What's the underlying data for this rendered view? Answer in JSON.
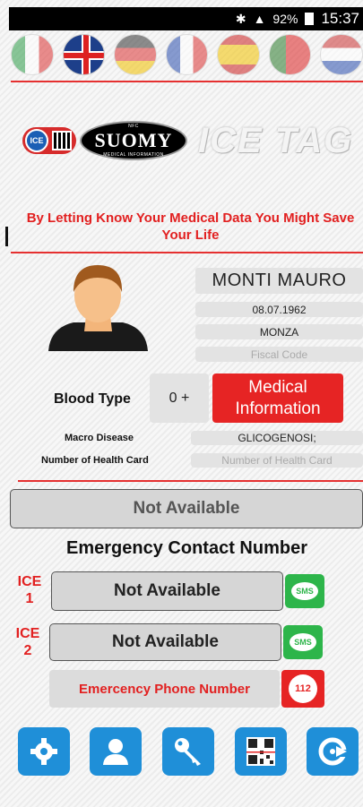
{
  "status_bar": {
    "battery": "92%",
    "time": "15:37"
  },
  "languages": [
    {
      "name": "italian-flag",
      "active": false
    },
    {
      "name": "english-flag",
      "active": true
    },
    {
      "name": "german-flag",
      "active": false
    },
    {
      "name": "french-flag",
      "active": false
    },
    {
      "name": "spanish-flag",
      "active": false
    },
    {
      "name": "portuguese-flag",
      "active": false
    },
    {
      "name": "dutch-flag",
      "active": false
    }
  ],
  "logo": {
    "ice": "ICE",
    "brand": "SUOMY",
    "brand_sub": "MEDICAL INFORMATION",
    "nfc": "NFC",
    "app_name": "ICE TAG"
  },
  "slogan": "By Letting Know Your Medical Data You Might Save Your Life",
  "profile": {
    "name": "MONTI MAURO",
    "birth_date": "08.07.1962",
    "city": "MONZA",
    "fiscal_code_placeholder": "Fiscal Code"
  },
  "blood": {
    "label": "Blood Type",
    "value": "0 +"
  },
  "medical_button": "Medical Information",
  "macro_disease": {
    "label": "Macro Disease",
    "value": "GLICOGENOSI;"
  },
  "health_card": {
    "label": "Number of Health Card",
    "placeholder": "Number of Health Card"
  },
  "not_available_main": "Not Available",
  "emergency": {
    "title": "Emergency Contact Number",
    "ice1": {
      "tag": "ICE 1",
      "value": "Not Available"
    },
    "ice2": {
      "tag": "ICE 2",
      "value": "Not Available"
    },
    "sms_label": "SMS",
    "phone_label": "Emercency Phone Number",
    "call_label": "112"
  },
  "toolbar": [
    "settings-icon",
    "profile-icon",
    "key-icon",
    "qr-code-icon",
    "refresh-icon"
  ],
  "colors": {
    "accent_red": "#e62424",
    "sms_green": "#2db54a",
    "tool_blue": "#1f8fd8"
  }
}
